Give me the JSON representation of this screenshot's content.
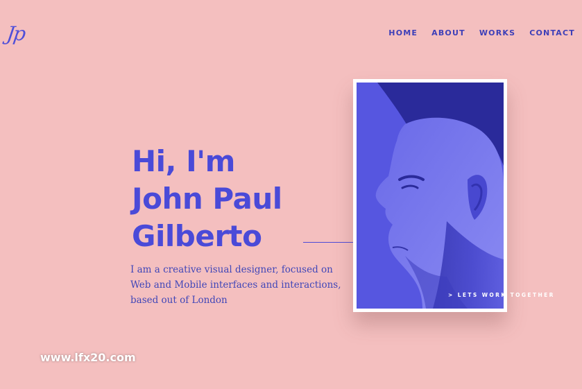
{
  "brand": {
    "logo_text": "Jp"
  },
  "nav": {
    "items": [
      "HOME",
      "ABOUT",
      "WORKS",
      "CONTACT"
    ]
  },
  "hero": {
    "title_lines": [
      "Hi, I'm",
      "John Paul",
      "Gilberto"
    ],
    "intro_lines": [
      "I am a creative visual designer, focused on",
      "Web and Mobile interfaces and interactions,",
      "based out of London"
    ],
    "cta_label": "> LETS WORK TOGETHER"
  },
  "watermark": "www.lfx20.com",
  "colors": {
    "background": "#f4bfbf",
    "accent": "#4a4ad8",
    "photo_tint": "#5656e0",
    "frame": "#ffffff"
  }
}
